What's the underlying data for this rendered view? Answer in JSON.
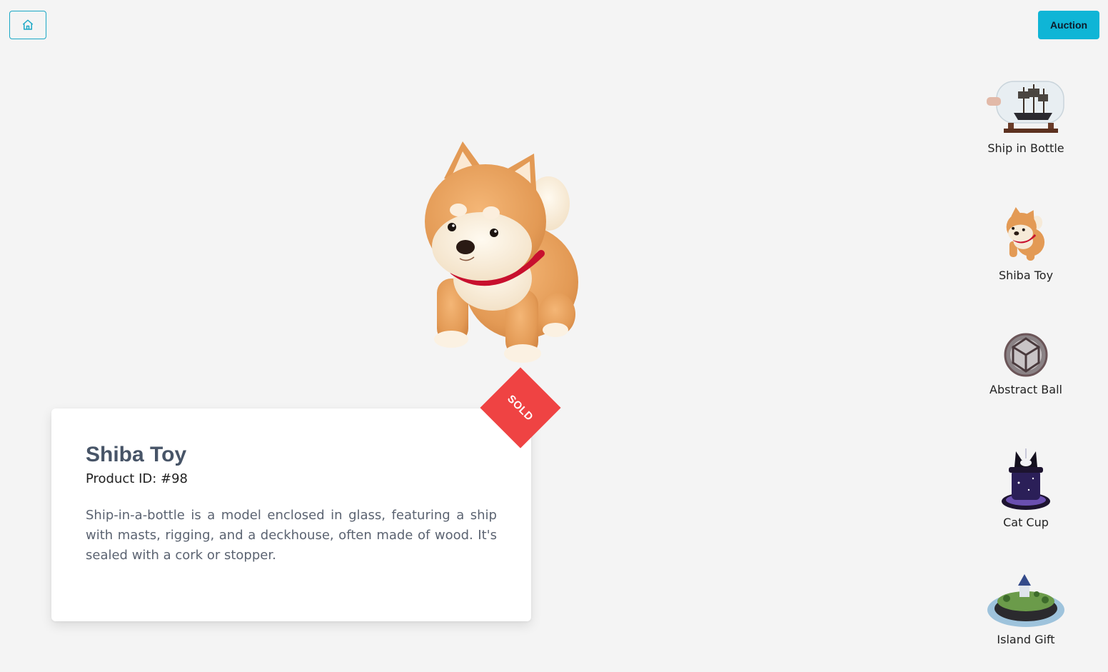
{
  "header": {
    "home_icon": "home-icon",
    "auction_label": "Auction"
  },
  "product": {
    "title": "Shiba Toy",
    "product_id": "Product ID: #98",
    "description": "Ship-in-a-bottle is a model enclosed in glass, featuring a ship with masts, rigging, and a deckhouse, often made of wood. It's sealed with a cork or stopper.",
    "badge": "SOLD"
  },
  "sidebar": {
    "items": [
      {
        "label": "Ship in Bottle"
      },
      {
        "label": "Shiba Toy"
      },
      {
        "label": "Abstract Ball"
      },
      {
        "label": "Cat Cup"
      },
      {
        "label": "Island Gift"
      }
    ]
  },
  "colors": {
    "accent": "#0fb5d6",
    "sold": "#ef4343",
    "background": "#f4f4f4"
  }
}
